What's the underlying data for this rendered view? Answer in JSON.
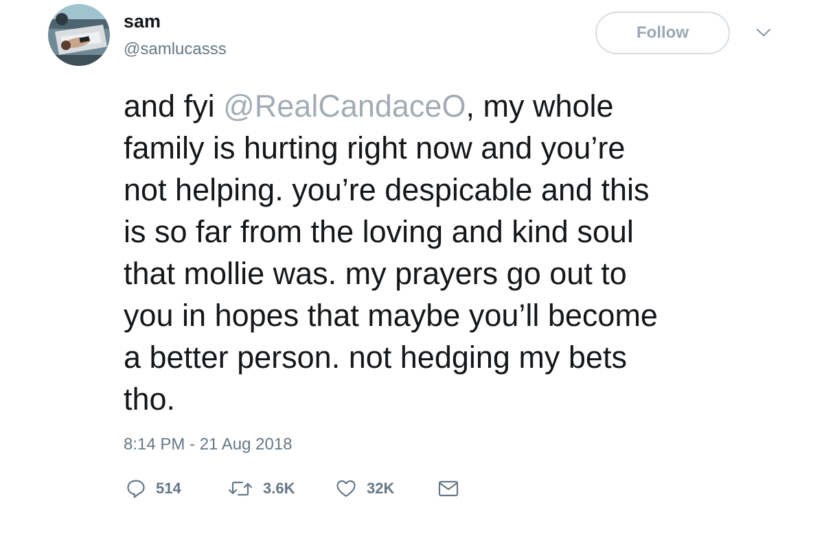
{
  "user": {
    "display_name": "sam",
    "handle": "@samlucasss",
    "avatar_icon": "profile-photo"
  },
  "header": {
    "follow_label": "Follow",
    "caret_icon": "chevron-down-icon"
  },
  "tweet": {
    "lines": [
      {
        "before": "and fyi ",
        "mention": "@RealCandaceO",
        "after": ", my whole"
      },
      {
        "text": "family is hurting right now and you’re"
      },
      {
        "text": "not helping. you’re despicable and this"
      },
      {
        "text": "is so far from the loving and kind soul"
      },
      {
        "text": "that mollie was. my prayers go out to"
      },
      {
        "text": "you in hopes that maybe you’ll become"
      },
      {
        "text": "a better person. not hedging my bets"
      },
      {
        "text": "tho."
      }
    ],
    "timestamp": "8:14 PM - 21 Aug 2018"
  },
  "actions": {
    "reply": {
      "icon": "reply-icon",
      "count": "514"
    },
    "retweet": {
      "icon": "retweet-icon",
      "count": "3.6K"
    },
    "like": {
      "icon": "heart-icon",
      "count": "32K"
    },
    "message": {
      "icon": "envelope-icon"
    }
  },
  "colors": {
    "text": "#14171a",
    "secondary": "#657786",
    "mention": "#a3acb5",
    "button_border": "#d6dde3"
  }
}
